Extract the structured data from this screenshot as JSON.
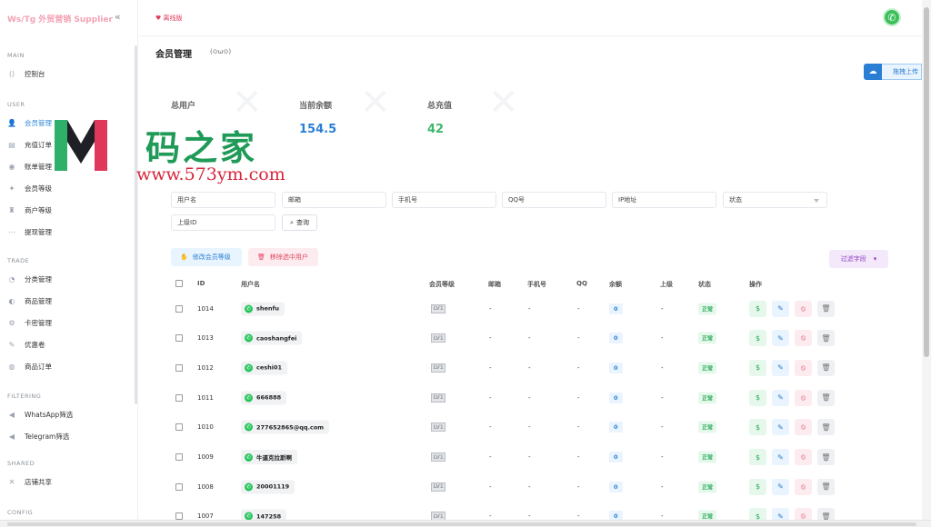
{
  "app": {
    "logo": "Ws/Tg 外贸营销 Supplier",
    "collapse_icon": "«"
  },
  "sidebar": {
    "sections": [
      {
        "label": "MAIN",
        "items": [
          {
            "label": "控制台",
            "icon": "code-icon",
            "active": false
          }
        ]
      },
      {
        "label": "USER",
        "items": [
          {
            "label": "会员管理",
            "icon": "user-icon",
            "active": true
          },
          {
            "label": "充值订单",
            "icon": "receipt-icon",
            "active": false
          },
          {
            "label": "账单管理",
            "icon": "bill-icon",
            "active": false
          },
          {
            "label": "会员等级",
            "icon": "grid-icon",
            "active": false
          },
          {
            "label": "商户等级",
            "icon": "shop-icon",
            "active": false
          },
          {
            "label": "提现管理",
            "icon": "withdraw-icon",
            "active": false
          }
        ]
      },
      {
        "label": "TRADE",
        "items": [
          {
            "label": "分类管理",
            "icon": "category-icon",
            "active": false
          },
          {
            "label": "商品管理",
            "icon": "product-icon",
            "active": false
          },
          {
            "label": "卡密管理",
            "icon": "key-icon",
            "active": false
          },
          {
            "label": "优惠卷",
            "icon": "coupon-icon",
            "active": false
          },
          {
            "label": "商品订单",
            "icon": "order-icon",
            "active": false
          }
        ]
      },
      {
        "label": "FILTERING",
        "items": [
          {
            "label": "WhatsApp筛选",
            "icon": "circle-arrow-icon",
            "active": false
          },
          {
            "label": "Telegram筛选",
            "icon": "circle-arrow-icon",
            "active": false
          }
        ]
      },
      {
        "label": "SHARED",
        "items": [
          {
            "label": "店铺共享",
            "icon": "share-icon",
            "active": false
          }
        ]
      },
      {
        "label": "CONFIG",
        "items": []
      }
    ]
  },
  "topbar": {
    "status_label": "离线版"
  },
  "page": {
    "title": "会员管理",
    "emoticon": "(⊙ω⊙)",
    "upload_label": "拖拽上传"
  },
  "stats": [
    {
      "label": "总用户",
      "value": "",
      "color": "#333333"
    },
    {
      "label": "当前余额",
      "value": "154.5",
      "color": "#2a7fd4"
    },
    {
      "label": "总充值",
      "value": "42",
      "color": "#3cb86a"
    }
  ],
  "watermark": {
    "letter": "M",
    "chinese": "码之家",
    "url": "www.573ym.com"
  },
  "filters": {
    "username": "用户名",
    "email": "邮箱",
    "phone": "手机号",
    "qq": "QQ号",
    "ip": "IP地址",
    "status": "状态",
    "parent_id": "上级ID",
    "search_button": "查询"
  },
  "actions": {
    "edit_level": "修改会员等级",
    "remove_users": "移除选中用户",
    "filter_fields": "过滤字段"
  },
  "table": {
    "headers": [
      "ID",
      "用户名",
      "会员等级",
      "邮箱",
      "手机号",
      "QQ",
      "余额",
      "上级",
      "状态",
      "操作"
    ],
    "rows": [
      {
        "id": "1014",
        "username": "shenfu",
        "level": "LV1",
        "email": "-",
        "phone": "-",
        "qq": "-",
        "balance": "0",
        "parent": "-",
        "status": "正常"
      },
      {
        "id": "1013",
        "username": "caoshangfei",
        "level": "LV1",
        "email": "-",
        "phone": "-",
        "qq": "-",
        "balance": "0",
        "parent": "-",
        "status": "正常"
      },
      {
        "id": "1012",
        "username": "ceshi01",
        "level": "LV1",
        "email": "-",
        "phone": "-",
        "qq": "-",
        "balance": "0",
        "parent": "-",
        "status": "正常"
      },
      {
        "id": "1011",
        "username": "666888",
        "level": "LV1",
        "email": "-",
        "phone": "-",
        "qq": "-",
        "balance": "0",
        "parent": "-",
        "status": "正常"
      },
      {
        "id": "1010",
        "username": "277652865@qq.com",
        "level": "LV1",
        "email": "-",
        "phone": "-",
        "qq": "-",
        "balance": "0",
        "parent": "-",
        "status": "正常"
      },
      {
        "id": "1009",
        "username": "牛逼克拉斯啊",
        "level": "LV1",
        "email": "-",
        "phone": "-",
        "qq": "-",
        "balance": "0",
        "parent": "-",
        "status": "正常"
      },
      {
        "id": "1008",
        "username": "20001119",
        "level": "LV1",
        "email": "-",
        "phone": "-",
        "qq": "-",
        "balance": "0",
        "parent": "-",
        "status": "正常"
      },
      {
        "id": "1007",
        "username": "147258",
        "level": "LV1",
        "email": "-",
        "phone": "-",
        "qq": "-",
        "balance": "0",
        "parent": "-",
        "status": "正常"
      }
    ]
  }
}
